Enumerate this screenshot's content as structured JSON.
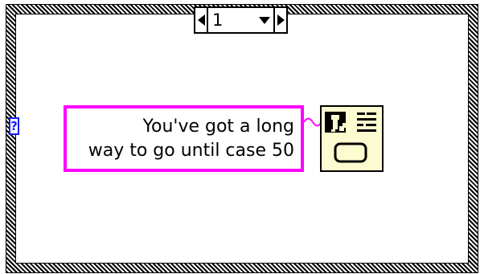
{
  "case_selector": {
    "value": "1",
    "decrement_icon": "left-arrow",
    "increment_icon": "right-arrow",
    "dropdown_icon": "down-arrow"
  },
  "selector_terminal": {
    "label": "?",
    "color": "#1a1aff"
  },
  "string_constant": {
    "line1": "You've got a long",
    "line2": "way to go until case 50",
    "border_color": "#ff00ff"
  },
  "dialog_vi": {
    "icon": "one-button-dialog-icon"
  }
}
